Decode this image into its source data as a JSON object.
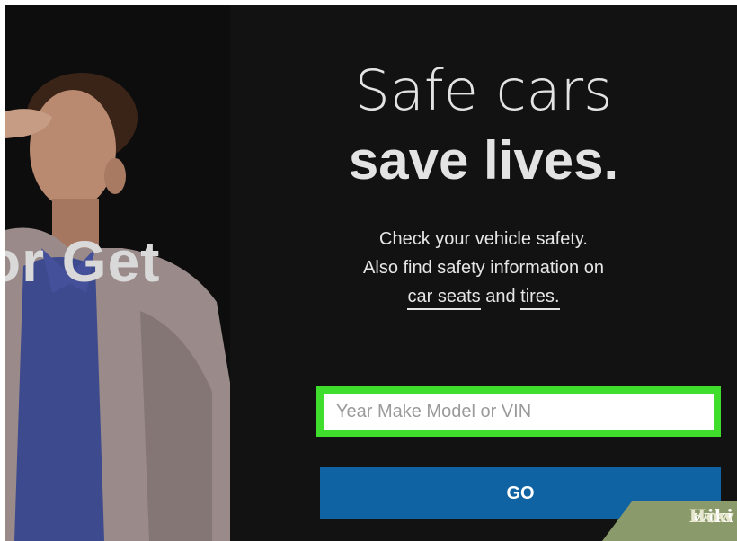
{
  "hero": {
    "headline_light": "Safe cars",
    "headline_bold": "save lives.",
    "description_line1": "Check your vehicle safety.",
    "description_line2": "Also find safety information on",
    "link_car_seats": "car seats",
    "connector": "and",
    "link_tires": "tires",
    "period": "."
  },
  "side_photo": {
    "overlay_text": "or Get"
  },
  "search": {
    "placeholder": "Year Make Model or VIN",
    "value": "",
    "highlight_color": "#3fdd2c"
  },
  "go_button": {
    "label": "GO",
    "color": "#0f63a3"
  },
  "watermark": {
    "part1": "wiki",
    "part2": "How"
  }
}
